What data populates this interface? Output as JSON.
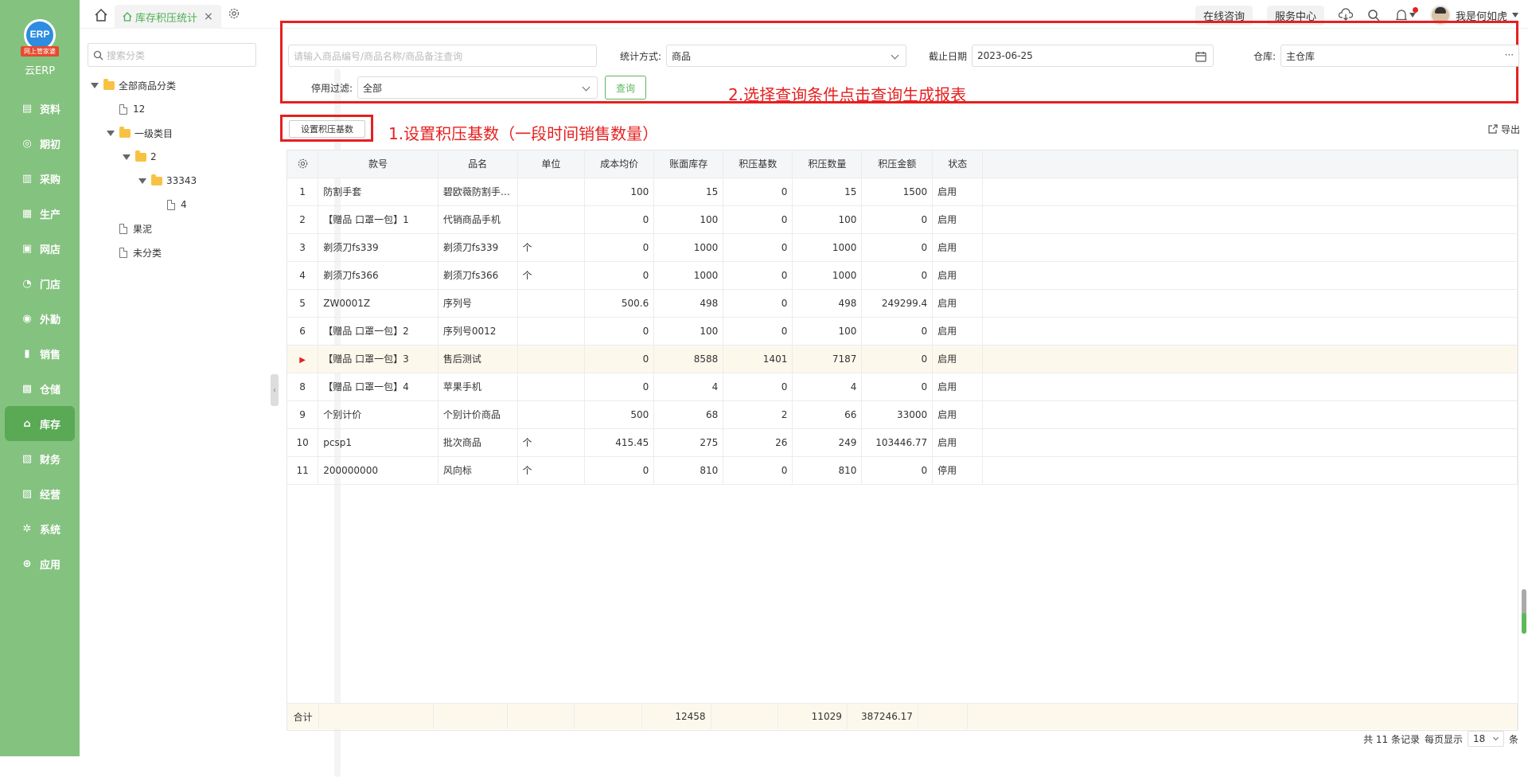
{
  "logo": {
    "badge": "ERP",
    "ribbon": "网上管家婆",
    "text": "云ERP"
  },
  "sidebar": {
    "items": [
      {
        "label": "资料",
        "icon": "folder-icon"
      },
      {
        "label": "期初",
        "icon": "target-icon"
      },
      {
        "label": "采购",
        "icon": "cart-icon"
      },
      {
        "label": "生产",
        "icon": "factory-icon"
      },
      {
        "label": "网店",
        "icon": "store-icon"
      },
      {
        "label": "门店",
        "icon": "pie-icon"
      },
      {
        "label": "外勤",
        "icon": "location-icon"
      },
      {
        "label": "销售",
        "icon": "chart-icon"
      },
      {
        "label": "仓储",
        "icon": "warehouse-icon"
      },
      {
        "label": "库存",
        "icon": "home-icon"
      },
      {
        "label": "财务",
        "icon": "wallet-icon"
      },
      {
        "label": "经营",
        "icon": "briefcase-icon"
      },
      {
        "label": "系统",
        "icon": "gear-icon"
      },
      {
        "label": "应用",
        "icon": "plus-icon"
      }
    ],
    "active_index": 9
  },
  "topbar": {
    "tab_label": "库存积压统计",
    "tab_close": "×",
    "online_consult": "在线咨询",
    "service_center": "服务中心",
    "username": "我是何如虎"
  },
  "tree": {
    "search_placeholder": "搜索分类",
    "nodes": [
      {
        "label": "全部商品分类",
        "type": "folder",
        "level": 0,
        "expanded": true
      },
      {
        "label": "12",
        "type": "file",
        "level": 1
      },
      {
        "label": "一级类目",
        "type": "folder",
        "level": 1,
        "expanded": true
      },
      {
        "label": "2",
        "type": "folder",
        "level": 2,
        "expanded": true
      },
      {
        "label": "33343",
        "type": "folder",
        "level": 3,
        "expanded": true
      },
      {
        "label": "4",
        "type": "file",
        "level": 4
      },
      {
        "label": "果泥",
        "type": "file",
        "level": 1
      },
      {
        "label": "未分类",
        "type": "file",
        "level": 1
      }
    ]
  },
  "filters": {
    "keyword_placeholder": "请输入商品编号/商品名称/商品备注查询",
    "stat_mode_label": "统计方式:",
    "stat_mode_value": "商品",
    "end_date_label": "截止日期",
    "end_date_value": "2023-06-25",
    "warehouse_label": "仓库:",
    "warehouse_value": "主仓库",
    "warehouse_more": "···",
    "disabled_filter_label": "停用过滤:",
    "disabled_filter_value": "全部",
    "query_button": "查询"
  },
  "annotations": {
    "step1": "1.设置积压基数（一段时间销售数量）",
    "step2": "2.选择查询条件点击查询生成报表"
  },
  "toolbar": {
    "set_base_button": "设置积压基数",
    "export_label": "导出"
  },
  "table": {
    "headers": [
      "款号",
      "品名",
      "单位",
      "成本均价",
      "账面库存",
      "积压基数",
      "积压数量",
      "积压金额",
      "状态"
    ],
    "rows": [
      {
        "idx": "1",
        "code": "防割手套",
        "name": "碧欧薇防割手…",
        "unit": "",
        "cost": "100",
        "stock": "15",
        "base": "0",
        "qty": "15",
        "amount": "1500",
        "status": "启用"
      },
      {
        "idx": "2",
        "code": "【赠品 口罩一包】1",
        "name": "代销商品手机",
        "unit": "",
        "cost": "0",
        "stock": "100",
        "base": "0",
        "qty": "100",
        "amount": "0",
        "status": "启用"
      },
      {
        "idx": "3",
        "code": "剃须刀fs339",
        "name": "剃须刀fs339",
        "unit": "个",
        "cost": "0",
        "stock": "1000",
        "base": "0",
        "qty": "1000",
        "amount": "0",
        "status": "启用"
      },
      {
        "idx": "4",
        "code": "剃须刀fs366",
        "name": "剃须刀fs366",
        "unit": "个",
        "cost": "0",
        "stock": "1000",
        "base": "0",
        "qty": "1000",
        "amount": "0",
        "status": "启用"
      },
      {
        "idx": "5",
        "code": "ZW0001Z",
        "name": "序列号",
        "unit": "",
        "cost": "500.6",
        "stock": "498",
        "base": "0",
        "qty": "498",
        "amount": "249299.4",
        "status": "启用"
      },
      {
        "idx": "6",
        "code": "【赠品 口罩一包】2",
        "name": "序列号0012",
        "unit": "",
        "cost": "0",
        "stock": "100",
        "base": "0",
        "qty": "100",
        "amount": "0",
        "status": "启用"
      },
      {
        "idx": "▶",
        "code": "【赠品 口罩一包】3",
        "name": "售后测试",
        "unit": "",
        "cost": "0",
        "stock": "8588",
        "base": "1401",
        "qty": "7187",
        "amount": "0",
        "status": "启用",
        "selected": true
      },
      {
        "idx": "8",
        "code": "【赠品 口罩一包】4",
        "name": "苹果手机",
        "unit": "",
        "cost": "0",
        "stock": "4",
        "base": "0",
        "qty": "4",
        "amount": "0",
        "status": "启用"
      },
      {
        "idx": "9",
        "code": "个别计价",
        "name": "个别计价商品",
        "unit": "",
        "cost": "500",
        "stock": "68",
        "base": "2",
        "qty": "66",
        "amount": "33000",
        "status": "启用"
      },
      {
        "idx": "10",
        "code": "pcsp1",
        "name": "批次商品",
        "unit": "个",
        "cost": "415.45",
        "stock": "275",
        "base": "26",
        "qty": "249",
        "amount": "103446.77",
        "status": "启用"
      },
      {
        "idx": "11",
        "code": "200000000",
        "name": "风向标",
        "unit": "个",
        "cost": "0",
        "stock": "810",
        "base": "0",
        "qty": "810",
        "amount": "0",
        "status": "停用"
      }
    ],
    "summary": {
      "label": "合计",
      "stock": "12458",
      "qty": "11029",
      "amount": "387246.17"
    }
  },
  "footer": {
    "total_text": "共 11 条记录",
    "per_page_label": "每页显示",
    "per_page_value": "18",
    "unit": "条"
  }
}
